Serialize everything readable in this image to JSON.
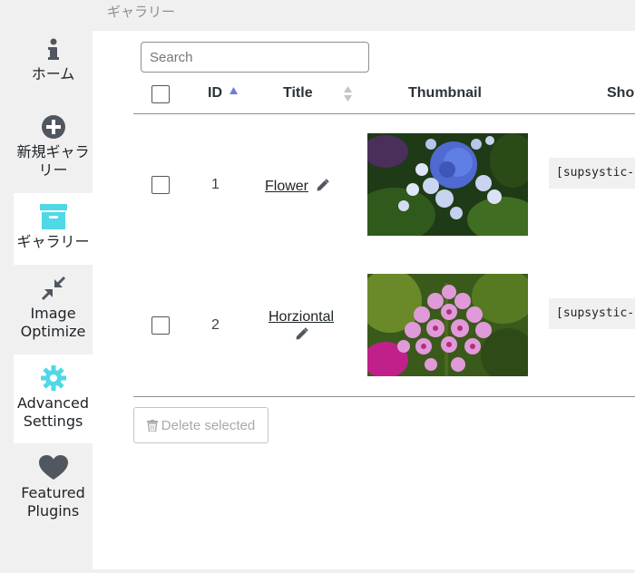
{
  "breadcrumb": "ギャラリー",
  "sidebar": {
    "items": [
      {
        "label": "ホーム",
        "icon": "info-icon"
      },
      {
        "label": "新規ギャラリー",
        "icon": "plus-circle-icon"
      },
      {
        "label": "ギャラリー",
        "icon": "archive-icon",
        "active": true
      },
      {
        "label": "Image Optimize",
        "icon": "compress-arrows-icon"
      },
      {
        "label": "Advanced Settings",
        "icon": "gear-icon",
        "active": true
      },
      {
        "label": "Featured Plugins",
        "icon": "heart-icon"
      }
    ]
  },
  "search": {
    "placeholder": "Search"
  },
  "table": {
    "headers": {
      "id": "ID",
      "title": "Title",
      "thumbnail": "Thumbnail",
      "shortcode": "Sho"
    },
    "sort": {
      "column": "ID",
      "direction": "asc"
    },
    "rows": [
      {
        "id": "1",
        "title": "Flower",
        "shortcode": "[supsystic-"
      },
      {
        "id": "2",
        "title": "Horziontal",
        "shortcode": "[supsystic-"
      }
    ]
  },
  "actions": {
    "delete_selected": "Delete selected"
  },
  "colors": {
    "accent_teal": "#4fd8e6",
    "sort_arrow": "#6f7bdb",
    "text": "#2c3338"
  }
}
